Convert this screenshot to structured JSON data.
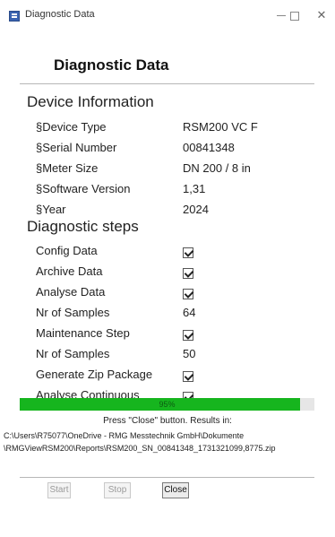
{
  "window": {
    "title": "Diagnostic Data",
    "heading": "Diagnostic Data"
  },
  "device_info": {
    "section_title": "Device Information",
    "rows": [
      {
        "label": "§Device Type",
        "value": "RSM200 VC F"
      },
      {
        "label": "§Serial Number",
        "value": "00841348"
      },
      {
        "label": "§Meter Size",
        "value": "DN 200 / 8 in"
      },
      {
        "label": "§Software Version",
        "value": "1,31"
      },
      {
        "label": "§Year",
        "value": "2024"
      }
    ]
  },
  "diagnostic_steps": {
    "section_title": "Diagnostic steps",
    "rows": [
      {
        "label": "Config Data",
        "checked": true
      },
      {
        "label": "Archive Data",
        "checked": true
      },
      {
        "label": "Analyse Data",
        "checked": true
      },
      {
        "label": "Nr of Samples",
        "value": "64"
      },
      {
        "label": "Maintenance Step",
        "checked": true
      },
      {
        "label": "Nr of Samples",
        "value": "50"
      },
      {
        "label": "Generate Zip Package",
        "checked": true
      },
      {
        "label": "Analyse Continuous",
        "checked": true
      }
    ]
  },
  "progress": {
    "percent": 95,
    "text": "95%",
    "color": "#16b51e"
  },
  "result": {
    "message": "Press \"Close\" button. Results in:",
    "path_line1": "C:\\Users\\R75077\\OneDrive - RMG Messtechnik GmbH\\Dokumente",
    "path_line2": "\\RMGViewRSM200\\Reports\\RSM200_SN_00841348_1731321099,8775.zip"
  },
  "buttons": {
    "start": "Start",
    "stop": "Stop",
    "close": "Close"
  },
  "icons": {
    "app": "app-icon",
    "checkbox": "checkmark-icon"
  }
}
